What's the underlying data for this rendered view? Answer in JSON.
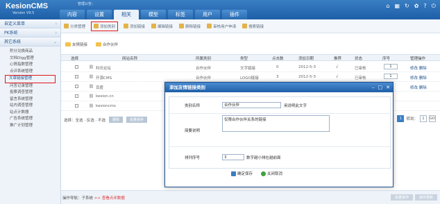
{
  "app": {
    "logo": "KesionCMS",
    "version": "Version V9.5",
    "notice": "管理公告："
  },
  "tabs": [
    "内容",
    "设置",
    "相关",
    "模型",
    "标签",
    "用户",
    "插件"
  ],
  "active_tab_index": 2,
  "top_icons": [
    "home-icon",
    "grid-icon",
    "refresh-icon",
    "gear-icon",
    "help-icon",
    "power-icon"
  ],
  "sidebar": {
    "sections": [
      "自定义菜单",
      "PK系统",
      "其它系统"
    ],
    "items": [
      "积分兑换商品",
      "文档Digg管理",
      "心情指数管理",
      "点评系统管理",
      "文章链接管理",
      "问答记录管理",
      "投票调查管理",
      "留言系统管理",
      "站内调查管理",
      "站点计数器",
      "广告系统管理",
      "推广计划管理"
    ],
    "highlight_index": 4
  },
  "toolbar": [
    {
      "label": "分类管理"
    },
    {
      "label": "添加类别"
    },
    {
      "label": "添加链接"
    },
    {
      "label": "编辑链接"
    },
    {
      "label": "删除链接"
    },
    {
      "label": "审核用户申请"
    },
    {
      "label": "搜索链接"
    }
  ],
  "subtabs": [
    "友情链接",
    "合作伙伴"
  ],
  "table": {
    "headers": [
      "选择",
      "网站名称",
      "所属类别",
      "类型",
      "点击数",
      "添加日期",
      "推荐",
      "状态",
      "序号",
      "管理操作"
    ],
    "rows": [
      {
        "name": "科讯论坛",
        "cat": "合作伙伴",
        "type": "文字链接",
        "clicks": "0",
        "date": "2012-5-3",
        "rec": "√",
        "status": "已审核",
        "seq": "1",
        "ops": "修改 删除"
      },
      {
        "name": "开源CMS",
        "cat": "合作伙伴",
        "type": "LOGO链接",
        "clicks": "3",
        "date": "2012-5-3",
        "rec": "√",
        "status": "已审核",
        "seq": "1",
        "ops": "修改 删除"
      },
      {
        "name": "百度",
        "cat": "合作伙伴",
        "type": "LOGO链接",
        "clicks": "",
        "date": "",
        "rec": "",
        "status": "已审核",
        "seq": "",
        "ops": "修改 删除"
      },
      {
        "name": "kesion.cn",
        "cat": "",
        "type": "",
        "clicks": "",
        "date": "",
        "rec": "",
        "status": "",
        "seq": "",
        "ops": ""
      },
      {
        "name": "kesioncms",
        "cat": "",
        "type": "",
        "clicks": "",
        "date": "",
        "rec": "",
        "status": "",
        "seq": "",
        "ops": ""
      }
    ]
  },
  "batch": {
    "label": "选择：全选 · 反选 · 不选",
    "delete": "删除",
    "save": "批量保存"
  },
  "pager": {
    "current": "1",
    "jump_label": "转到：",
    "jump_value": "1",
    "go": "GO"
  },
  "footer": {
    "crumb_prefix": "操作导航：子系统",
    "crumb_sep": ">>",
    "crumb_current": "查看点评数据",
    "btn1": "批量操作",
    "btn2": "操作更新"
  },
  "dialog": {
    "title": "添加友情链接类别",
    "category_label": "类别名称",
    "category_value": "合作伙伴",
    "category_hint": "用说明此文字",
    "desc_label": "简要说明",
    "desc_value": "仅限合作伙伴关系的链接",
    "order_label": "排列序号",
    "order_value": "3",
    "order_hint": "数字越小排在越前面",
    "save": "确定保存",
    "cancel": "关闭取消"
  }
}
